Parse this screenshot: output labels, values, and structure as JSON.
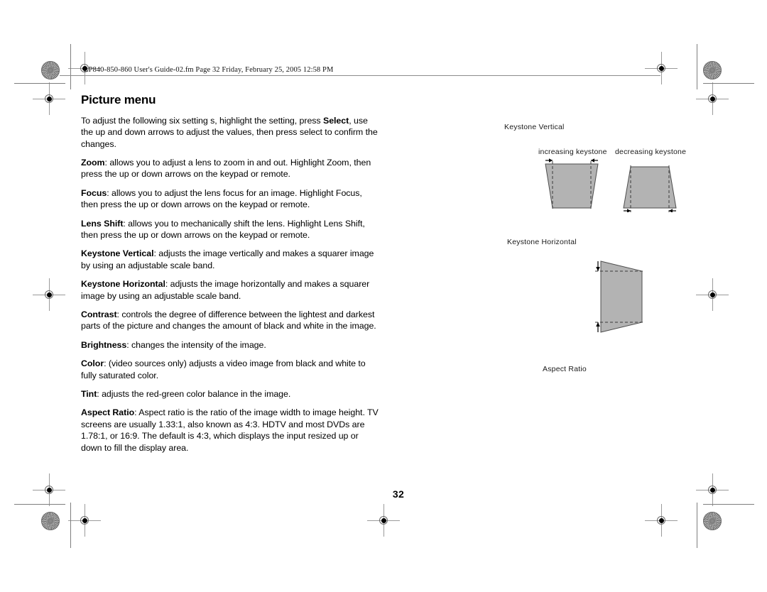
{
  "document": {
    "file_header": "LP840-850-860 User's Guide-02.fm  Page 32  Friday, February 25, 2005  12:58 PM",
    "page_number": "32",
    "title": "Picture menu"
  },
  "body": {
    "intro": {
      "pre": "To adjust the following six setting s, highlight the setting, press ",
      "bold": "Select",
      "post": ", use the up and down arrows to adjust the  values, then press select to confirm the changes."
    },
    "paragraphs": [
      {
        "term": "Zoom",
        "text": ": allows you to adjust a lens to zoom in and out. Highlight Zoom, then press the up or down arrows on the keypad or remote."
      },
      {
        "term": "Focus",
        "text": ": allows you to adjust the lens focus for an image. Highlight Focus, then press the up or down arrows on the keypad or remote."
      },
      {
        "term": "Lens Shift",
        "text": ": allows you to mechanically shift the lens. Highlight Lens Shift, then press the up or down arrows on the keypad or remote."
      },
      {
        "term": "Keystone Vertical",
        "text": ": adjusts the image vertically and makes a squarer image by using an adjustable scale band."
      },
      {
        "term": "Keystone Horizontal",
        "text": ": adjusts the image horizontally and makes a squarer image by using an adjustable scale band."
      },
      {
        "term": "Contrast",
        "text": ": controls the degree of difference between the lightest and darkest parts of the picture and changes the amount of black and white in the image."
      },
      {
        "term": "Brightness",
        "text": ": changes the intensity of the image."
      },
      {
        "term": "Color",
        "text": ": (video sources only) adjusts a video image from black and white to fully saturated color."
      },
      {
        "term": "Tint",
        "text": ": adjusts the red-green color balance in the image."
      },
      {
        "term": "Aspect Ratio",
        "text": ": Aspect ratio is the ratio of the image width to image height. TV screens are usually 1.33:1, also known as 4:3. HDTV and most DVDs are 1.78:1, or 16:9. The default is 4:3, which displays the input resized up or down to fill the display area."
      }
    ]
  },
  "figures": {
    "keystone_vertical": {
      "label": "Keystone Vertical",
      "captions": {
        "increasing": "increasing keystone",
        "decreasing": "decreasing keystone"
      }
    },
    "keystone_horizontal": {
      "label": "Keystone Horizontal"
    },
    "aspect_ratio": {
      "label": "Aspect Ratio"
    }
  },
  "colors": {
    "shape_fill": "#b3b3b3",
    "shape_stroke": "#4d4d4d",
    "text": "#000000",
    "rule": "#8c8c8c"
  }
}
